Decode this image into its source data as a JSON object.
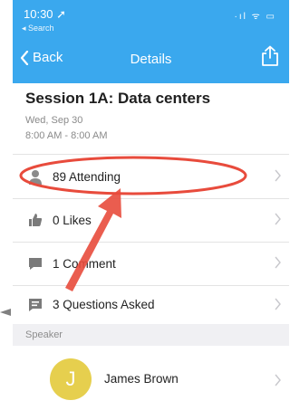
{
  "status_bar": {
    "time": "10:30 ➚",
    "back_app": "◂ Search",
    "icons": "·ıl ᯤ ▭"
  },
  "nav": {
    "back_label": "Back",
    "title": "Details"
  },
  "session": {
    "title": "Session 1A: Data centers",
    "date": "Wed, Sep 30",
    "time": "8:00 AM - 8:00 AM"
  },
  "rows": [
    {
      "label": "89 Attending",
      "icon": "person-icon"
    },
    {
      "label": "0 Likes",
      "icon": "thumbs-up-icon"
    },
    {
      "label": "1 Comment",
      "icon": "comment-icon"
    },
    {
      "label": "3 Questions Asked",
      "icon": "question-icon"
    }
  ],
  "speaker_section": {
    "header": "Speaker",
    "name": "James Brown",
    "initial": "J"
  },
  "colors": {
    "nav_bar": "#3aa8ee",
    "annotation_red": "#e84b3c",
    "avatar": "#e6cf4e"
  }
}
